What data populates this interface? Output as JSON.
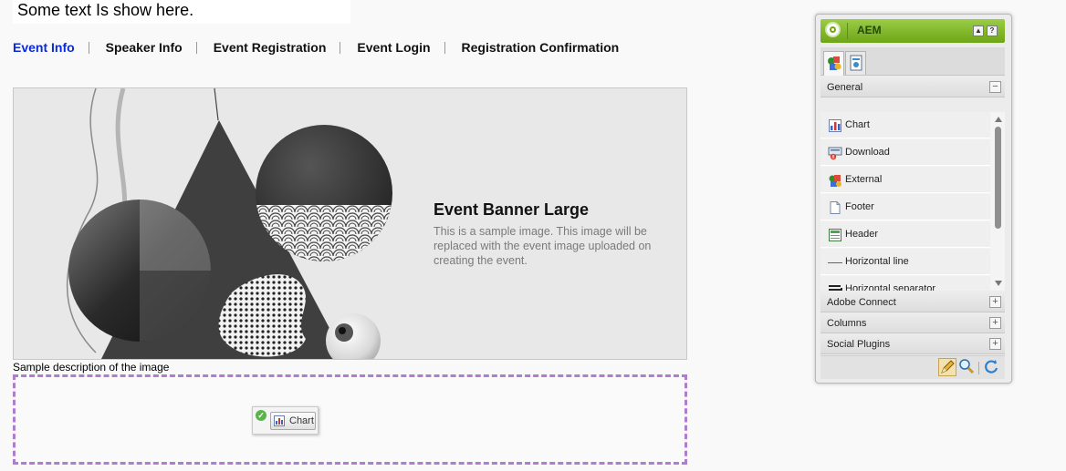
{
  "top_text": "Some text Is show here.",
  "nav": [
    {
      "label": "Event Info",
      "active": true
    },
    {
      "label": "Speaker Info",
      "active": false
    },
    {
      "label": "Event Registration",
      "active": false
    },
    {
      "label": "Event Login",
      "active": false
    },
    {
      "label": "Registration Confirmation",
      "active": false
    }
  ],
  "banner": {
    "title": "Event Banner Large",
    "text": "This is a sample image. This image will be replaced with the event image uploaded on creating the event."
  },
  "image_description": "Sample description of the image",
  "drag_item": {
    "label": "Chart",
    "icon": "chart-icon",
    "status_icon": "check-icon"
  },
  "sidekick": {
    "title": "AEM",
    "header_buttons": [
      "collapse-icon",
      "help-icon"
    ],
    "tabs": [
      {
        "icon": "components-icon",
        "active": true
      },
      {
        "icon": "page-icon",
        "active": false
      }
    ],
    "sections": [
      {
        "label": "General",
        "expanded": true,
        "toggle": "−"
      },
      {
        "label": "Adobe Connect",
        "expanded": false,
        "toggle": "+"
      },
      {
        "label": "Columns",
        "expanded": false,
        "toggle": "+"
      },
      {
        "label": "Social Plugins",
        "expanded": false,
        "toggle": "+"
      }
    ],
    "components": [
      {
        "label": "Chart",
        "icon": "chart-icon"
      },
      {
        "label": "Download",
        "icon": "download-icon"
      },
      {
        "label": "External",
        "icon": "external-icon"
      },
      {
        "label": "Footer",
        "icon": "footer-icon"
      },
      {
        "label": "Header",
        "icon": "header-icon"
      },
      {
        "label": "Horizontal line",
        "icon": "horizontal-line-icon"
      },
      {
        "label": "Horizontal separator",
        "icon": "horizontal-separator-icon"
      }
    ],
    "footer_buttons": [
      "edit-icon",
      "preview-icon",
      "refresh-icon"
    ]
  }
}
